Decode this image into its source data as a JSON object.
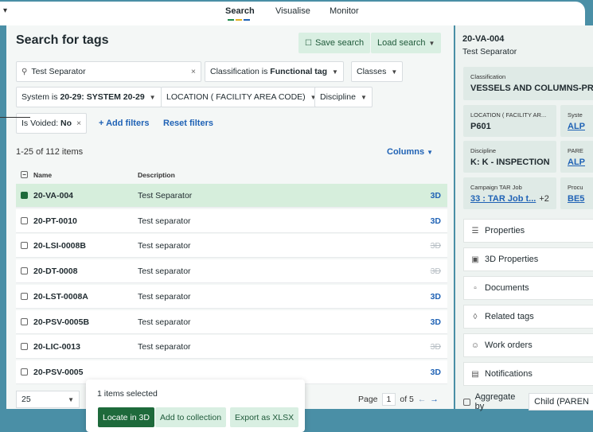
{
  "nav": {
    "tabs": [
      "Search",
      "Visualise",
      "Monitor"
    ],
    "active": "Search",
    "accent_colors": [
      "#1e8a4c",
      "#e0b020",
      "#1f62b5"
    ]
  },
  "search": {
    "title": "Search for tags",
    "save_label": "Save search",
    "load_label": "Load search",
    "query": "Test Separator",
    "filters": {
      "classification_prefix": "Classification is ",
      "classification_value": "Functional tag",
      "classes": "Classes",
      "system_prefix": "System is ",
      "system_value": "20-29: SYSTEM 20-29",
      "location": "LOCATION ( FACILITY AREA CODE)",
      "discipline": "Discipline",
      "voided_prefix": "Is Voided: ",
      "voided_value": "No"
    },
    "add_filters": "+ Add filters",
    "reset_filters": "Reset filters"
  },
  "results": {
    "count": "1-25 of 112 items",
    "columns_label": "Columns",
    "headers": {
      "name": "Name",
      "description": "Description"
    },
    "rows": [
      {
        "name": "20-VA-004",
        "description": "Test Separator",
        "tag": "3D",
        "available": true,
        "selected": true
      },
      {
        "name": "20-PT-0010",
        "description": "Test separator",
        "tag": "3D",
        "available": true,
        "selected": false
      },
      {
        "name": "20-LSI-0008B",
        "description": "Test separator",
        "tag": "3D",
        "available": false,
        "selected": false
      },
      {
        "name": "20-DT-0008",
        "description": "Test separator",
        "tag": "3D",
        "available": false,
        "selected": false
      },
      {
        "name": "20-LST-0008A",
        "description": "Test separator",
        "tag": "3D",
        "available": true,
        "selected": false
      },
      {
        "name": "20-PSV-0005B",
        "description": "Test separator",
        "tag": "3D",
        "available": true,
        "selected": false
      },
      {
        "name": "20-LIC-0013",
        "description": "Test separator",
        "tag": "3D",
        "available": false,
        "selected": false
      },
      {
        "name": "20-PSV-0005",
        "description": "",
        "tag": "3D",
        "available": true,
        "selected": false
      }
    ]
  },
  "selection": {
    "text": "1 items selected",
    "locate": "Locate in 3D",
    "add_collection": "Add to collection",
    "export": "Export as XLSX"
  },
  "pager": {
    "size": "25",
    "label": "Page",
    "current": "1",
    "of": "of 5"
  },
  "detail": {
    "tag": "20-VA-004",
    "description": "Test Separator",
    "classification_label": "Classification",
    "classification_value": "VESSELS AND COLUMNS-PRE",
    "location_label": "LOCATION ( FACILITY AR...",
    "location_value": "P601",
    "system_label": "Syste",
    "system_value": "ALP",
    "discipline_label": "Discipline",
    "discipline_value": "K: K - INSPECTION",
    "parent_label": "PARE",
    "parent_value": "ALP",
    "campaign_label": "Campaign TAR Job",
    "campaign_value": "33 : TAR Job t...",
    "campaign_more": "+2",
    "proc_label": "Procu",
    "proc_value": "BE5",
    "menu": [
      "Properties",
      "3D Properties",
      "Documents",
      "Related tags",
      "Work orders",
      "Notifications"
    ],
    "aggregate_label": "Aggregate by",
    "aggregate_value": "Child (PAREN"
  }
}
